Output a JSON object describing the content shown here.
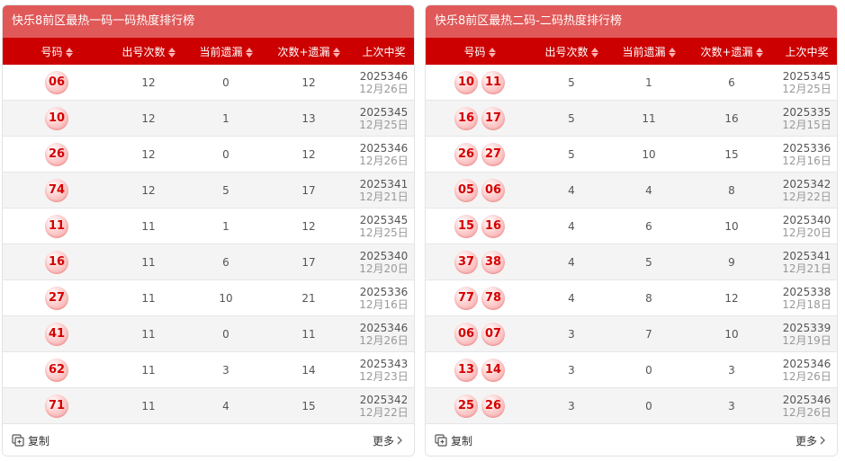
{
  "left": {
    "title": "快乐8前区最热一码一码热度排行榜",
    "headers": [
      "号码",
      "出号次数",
      "当前遗漏",
      "次数+遗漏",
      "上次中奖"
    ],
    "rows": [
      {
        "nums": [
          "06"
        ],
        "count": "12",
        "miss": "0",
        "sum": "12",
        "issue": "2025346",
        "date": "12月26日"
      },
      {
        "nums": [
          "10"
        ],
        "count": "12",
        "miss": "1",
        "sum": "13",
        "issue": "2025345",
        "date": "12月25日"
      },
      {
        "nums": [
          "26"
        ],
        "count": "12",
        "miss": "0",
        "sum": "12",
        "issue": "2025346",
        "date": "12月26日"
      },
      {
        "nums": [
          "74"
        ],
        "count": "12",
        "miss": "5",
        "sum": "17",
        "issue": "2025341",
        "date": "12月21日"
      },
      {
        "nums": [
          "11"
        ],
        "count": "11",
        "miss": "1",
        "sum": "12",
        "issue": "2025345",
        "date": "12月25日"
      },
      {
        "nums": [
          "16"
        ],
        "count": "11",
        "miss": "6",
        "sum": "17",
        "issue": "2025340",
        "date": "12月20日"
      },
      {
        "nums": [
          "27"
        ],
        "count": "11",
        "miss": "10",
        "sum": "21",
        "issue": "2025336",
        "date": "12月16日"
      },
      {
        "nums": [
          "41"
        ],
        "count": "11",
        "miss": "0",
        "sum": "11",
        "issue": "2025346",
        "date": "12月26日"
      },
      {
        "nums": [
          "62"
        ],
        "count": "11",
        "miss": "3",
        "sum": "14",
        "issue": "2025343",
        "date": "12月23日"
      },
      {
        "nums": [
          "71"
        ],
        "count": "11",
        "miss": "4",
        "sum": "15",
        "issue": "2025342",
        "date": "12月22日"
      }
    ],
    "copy_label": "复制",
    "more_label": "更多"
  },
  "right": {
    "title": "快乐8前区最热二码-二码热度排行榜",
    "headers": [
      "号码",
      "出号次数",
      "当前遗漏",
      "次数+遗漏",
      "上次中奖"
    ],
    "rows": [
      {
        "nums": [
          "10",
          "11"
        ],
        "count": "5",
        "miss": "1",
        "sum": "6",
        "issue": "2025345",
        "date": "12月25日"
      },
      {
        "nums": [
          "16",
          "17"
        ],
        "count": "5",
        "miss": "11",
        "sum": "16",
        "issue": "2025335",
        "date": "12月15日"
      },
      {
        "nums": [
          "26",
          "27"
        ],
        "count": "5",
        "miss": "10",
        "sum": "15",
        "issue": "2025336",
        "date": "12月16日"
      },
      {
        "nums": [
          "05",
          "06"
        ],
        "count": "4",
        "miss": "4",
        "sum": "8",
        "issue": "2025342",
        "date": "12月22日"
      },
      {
        "nums": [
          "15",
          "16"
        ],
        "count": "4",
        "miss": "6",
        "sum": "10",
        "issue": "2025340",
        "date": "12月20日"
      },
      {
        "nums": [
          "37",
          "38"
        ],
        "count": "4",
        "miss": "5",
        "sum": "9",
        "issue": "2025341",
        "date": "12月21日"
      },
      {
        "nums": [
          "77",
          "78"
        ],
        "count": "4",
        "miss": "8",
        "sum": "12",
        "issue": "2025338",
        "date": "12月18日"
      },
      {
        "nums": [
          "06",
          "07"
        ],
        "count": "3",
        "miss": "7",
        "sum": "10",
        "issue": "2025339",
        "date": "12月19日"
      },
      {
        "nums": [
          "13",
          "14"
        ],
        "count": "3",
        "miss": "0",
        "sum": "3",
        "issue": "2025346",
        "date": "12月26日"
      },
      {
        "nums": [
          "25",
          "26"
        ],
        "count": "3",
        "miss": "0",
        "sum": "3",
        "issue": "2025346",
        "date": "12月26日"
      }
    ],
    "copy_label": "复制",
    "more_label": "更多"
  },
  "icons": {
    "copy": "copy-icon",
    "more": "chevron-right-icon",
    "sort": "sort-icon"
  },
  "colors": {
    "title_bg": "#e05858",
    "header_bg": "#cc0000",
    "ball_text": "#d40000"
  }
}
